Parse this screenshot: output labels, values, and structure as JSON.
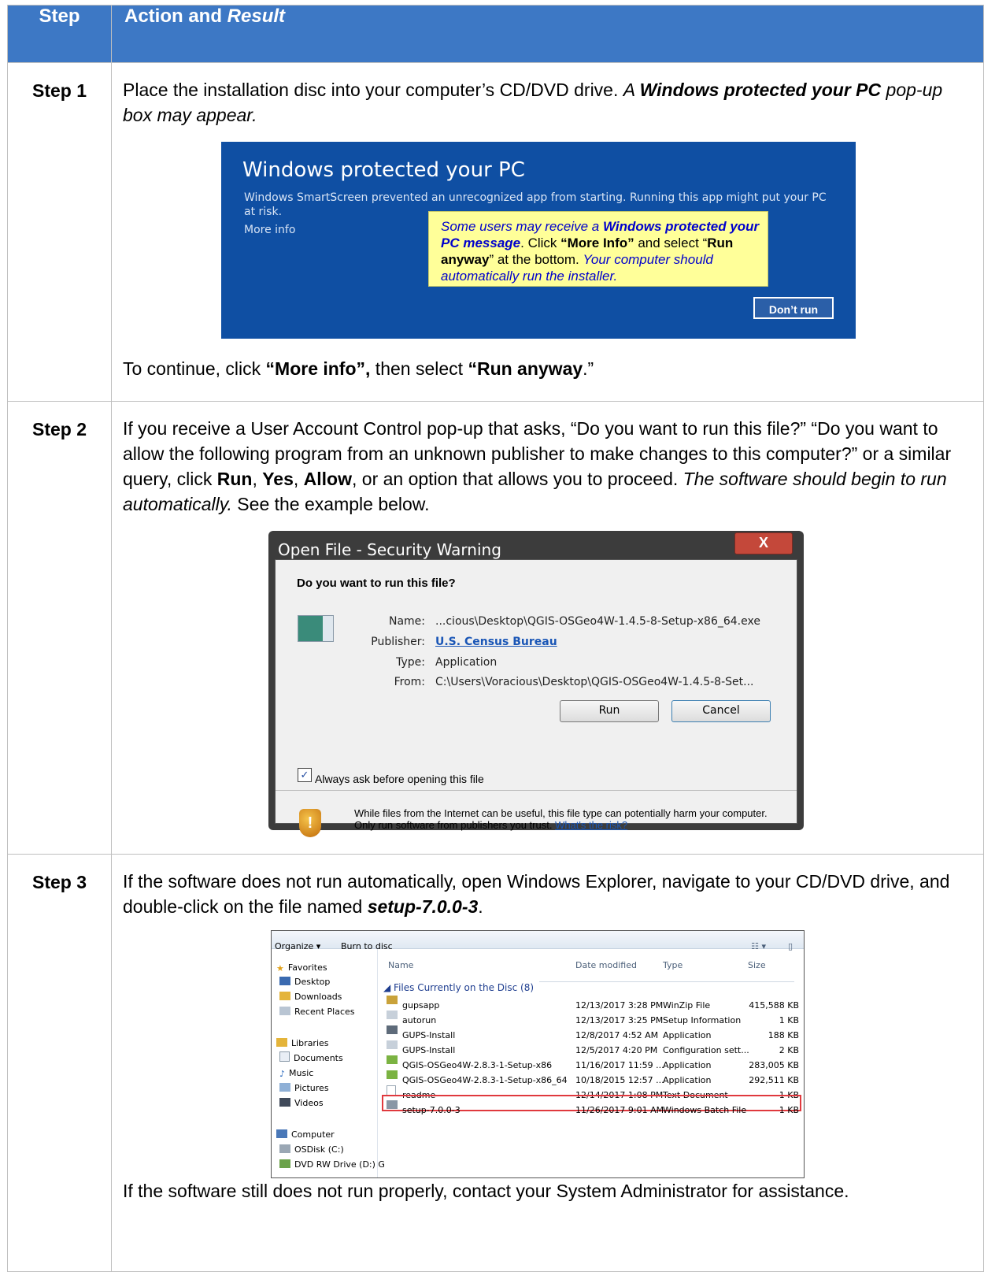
{
  "header": {
    "step": "Step",
    "action": "Action and",
    "result": "Result"
  },
  "step1": {
    "label": "Step 1",
    "p1_a": "Place the installation disc into your computer’s CD/DVD drive. ",
    "p1_b": "A ",
    "p1_c": "Windows protected your PC",
    "p1_d": " pop-up box may appear.",
    "smartscreen": {
      "title": "Windows protected your PC",
      "desc": "Windows SmartScreen prevented an unrecognized app from starting. Running this app might put your PC at risk.",
      "more_info": "More info",
      "callout_a": "Some users may receive a ",
      "callout_b": "Windows protected your PC message",
      "callout_c": ". Click ",
      "callout_d": "“More Info”",
      "callout_e": " and select “",
      "callout_f": "Run anyway",
      "callout_g": "” at the bottom. ",
      "callout_h": "Your computer should automatically run the installer.",
      "dont_run": "Don’t run"
    },
    "p2_a": "To continue, click ",
    "p2_b": "“More info”,",
    "p2_c": " then select ",
    "p2_d": "“Run anyway",
    "p2_e": ".”"
  },
  "step2": {
    "label": "Step 2",
    "p_a": "If you receive a User Account Control pop-up that asks, “Do you want to run this file?” “Do you want to allow the following program from an unknown publisher to make changes to this computer?” or a similar query, click ",
    "run": "Run",
    "c1": ", ",
    "yes": "Yes",
    "c2": ", ",
    "allow": "Allow",
    "p_b": ", or an option that allows you to proceed. ",
    "p_c": "The software should begin to run automatically.",
    "p_d": " See the example below.",
    "dialog": {
      "title": "Open File - Security Warning",
      "close": "X",
      "question": "Do you want to run this file?",
      "name_label": "Name:",
      "name_value": "...cious\\Desktop\\QGIS-OSGeo4W-1.4.5-8-Setup-x86_64.exe",
      "publisher_label": "Publisher:",
      "publisher_value": "U.S. Census Bureau",
      "type_label": "Type:",
      "type_value": "Application",
      "from_label": "From:",
      "from_value": "C:\\Users\\Voracious\\Desktop\\QGIS-OSGeo4W-1.4.5-8-Set...",
      "run_button": "Run",
      "cancel_button": "Cancel",
      "checkbox_label": "Always ask before opening this file",
      "warning_text": "While files from the Internet can be useful, this file type can potentially harm your computer. Only run software from publishers you trust. ",
      "risk_link": "What's the risk?"
    }
  },
  "step3": {
    "label": "Step 3",
    "p_a": "If the software does not run automatically, open Windows Explorer, navigate to your CD/DVD drive, and double-click on the file named ",
    "p_b": "setup-7.0.0-3",
    "p_c": ".",
    "explorer": {
      "organize": "Organize ▾",
      "burn": "Burn to disc",
      "nav": [
        "Favorites",
        "Desktop",
        "Downloads",
        "Recent Places",
        "Libraries",
        "Documents",
        "Music",
        "Pictures",
        "Videos",
        "Computer",
        "OSDisk (C:)",
        "DVD RW Drive (D:) G"
      ],
      "cols": [
        "Name",
        "Date modified",
        "Type",
        "Size"
      ],
      "group": "◢ Files Currently on the Disc (8)",
      "files": [
        {
          "name": "gupsapp",
          "date": "12/13/2017 3:28 PM",
          "type": "WinZip File",
          "size": "415,588 KB"
        },
        {
          "name": "autorun",
          "date": "12/13/2017 3:25 PM",
          "type": "Setup Information",
          "size": "1 KB"
        },
        {
          "name": "GUPS-Install",
          "date": "12/8/2017 4:52 AM",
          "type": "Application",
          "size": "188 KB"
        },
        {
          "name": "GUPS-Install",
          "date": "12/5/2017 4:20 PM",
          "type": "Configuration sett...",
          "size": "2 KB"
        },
        {
          "name": "QGIS-OSGeo4W-2.8.3-1-Setup-x86",
          "date": "11/16/2017 11:59 ...",
          "type": "Application",
          "size": "283,005 KB"
        },
        {
          "name": "QGIS-OSGeo4W-2.8.3-1-Setup-x86_64",
          "date": "10/18/2015 12:57 ...",
          "type": "Application",
          "size": "292,511 KB"
        },
        {
          "name": "readme",
          "date": "12/14/2017 1:08 PM",
          "type": "Text Document",
          "size": "1 KB"
        },
        {
          "name": "setup-7.0.0-3",
          "date": "11/26/2017 9:01 AM",
          "type": "Windows Batch File",
          "size": "1 KB"
        }
      ]
    },
    "after": "If the software still does not run properly, contact your System Administrator for assistance."
  }
}
